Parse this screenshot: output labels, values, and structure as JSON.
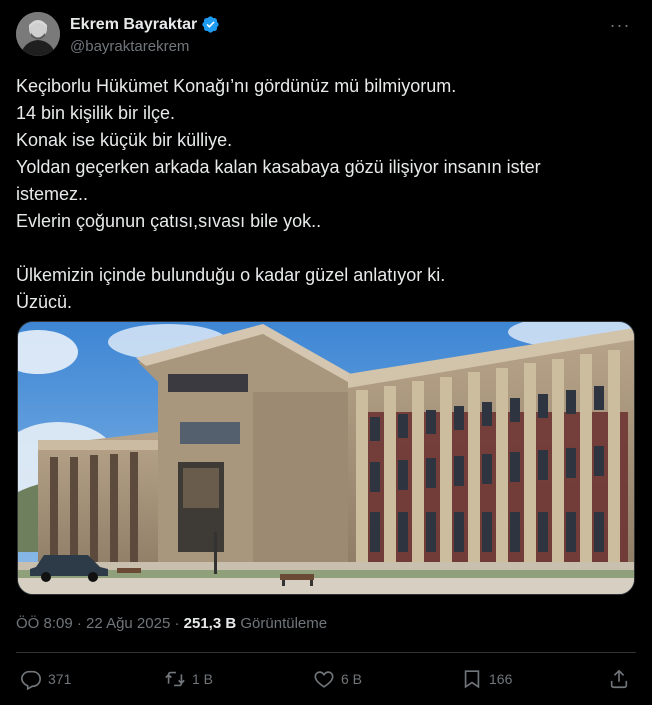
{
  "author": {
    "display_name": "Ekrem Bayraktar",
    "handle": "@bayraktarekrem",
    "verified": true,
    "verified_color": "#1d9bf0"
  },
  "more_label": "···",
  "tweet": {
    "lines": [
      "Keçiborlu Hükümet Konağı’nı gördünüz mü bilmiyorum.",
      "14 bin kişilik bir ilçe.",
      "Konak ise küçük bir külliye.",
      "Yoldan geçerken arkada kalan kasabaya gözü ilişiyor insanın ister",
      "istemez..",
      "Evlerin çoğunun çatısı,sıvası bile yok..",
      "",
      "Ülkemizin içinde bulunduğu o kadar güzel anlatıyor ki.",
      "Üzücü."
    ]
  },
  "meta": {
    "time": "ÖÖ 8:09",
    "separator": "·",
    "date": "22 Ağu 2025",
    "views_count": "251,3 B",
    "views_label": "Görüntüleme"
  },
  "actions": {
    "reply_count": "371",
    "repost_count": "1 B",
    "like_count": "6 B",
    "bookmark_count": "166"
  },
  "icons": {
    "reply": "reply-icon",
    "repost": "repost-icon",
    "like": "heart-icon",
    "bookmark": "bookmark-icon",
    "share": "share-icon"
  },
  "colors": {
    "background": "#000000",
    "text": "#e7e9ea",
    "secondary": "#71767b",
    "divider": "#2f3336"
  }
}
